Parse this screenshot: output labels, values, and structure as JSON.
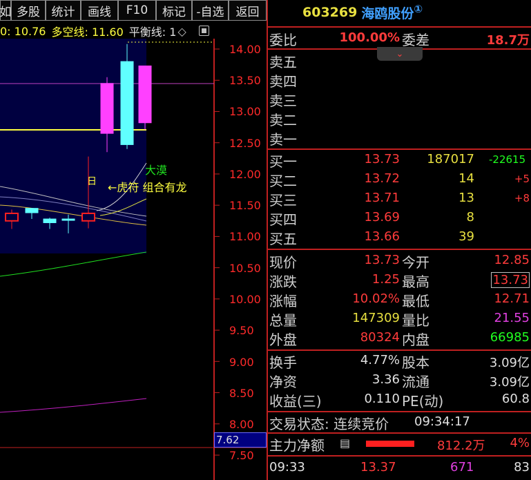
{
  "toolbar": {
    "buttons": [
      "如",
      "多股",
      "统计",
      "画线",
      "F10",
      "标记",
      "-自选",
      "返回"
    ]
  },
  "indicator_line": {
    "prefix": "0: 10.76",
    "dk_label": "多空线: 11.60",
    "ph_label": "平衡线: 1",
    "diamond": "◇"
  },
  "y_axis": {
    "labels": [
      "14.00",
      "13.50",
      "13.00",
      "12.50",
      "12.00",
      "11.50",
      "11.00",
      "10.50",
      "10.00",
      "9.50",
      "9.00",
      "8.50",
      "8.00",
      "7.50"
    ],
    "cursor_value": "7.62"
  },
  "annotations": {
    "da_mo": "大漠",
    "hu_fu": "←虎符 组合有龙",
    "ri": "日"
  },
  "stock": {
    "code": "603269",
    "name": "海鸥股份",
    "badge": "①"
  },
  "weibi": {
    "label": "委比",
    "value": "100.00%",
    "diff_label": "委差",
    "diff_value": "18.7万"
  },
  "expand_icon": "⌄",
  "sell": [
    {
      "label": "卖五"
    },
    {
      "label": "卖四"
    },
    {
      "label": "卖三"
    },
    {
      "label": "卖二"
    },
    {
      "label": "卖一"
    }
  ],
  "buy": [
    {
      "label": "买一",
      "price": "13.73",
      "vol": "187017",
      "chg": "-22615"
    },
    {
      "label": "买二",
      "price": "13.72",
      "vol": "14",
      "chg": "+5"
    },
    {
      "label": "买三",
      "price": "13.71",
      "vol": "13",
      "chg": "+8"
    },
    {
      "label": "买四",
      "price": "13.69",
      "vol": "8",
      "chg": ""
    },
    {
      "label": "买五",
      "price": "13.66",
      "vol": "39",
      "chg": ""
    }
  ],
  "stats1": [
    {
      "l1": "现价",
      "v1": "13.73",
      "l2": "今开",
      "v2": "12.85"
    },
    {
      "l1": "涨跌",
      "v1": "1.25",
      "l2": "最高",
      "v2": "13.73"
    },
    {
      "l1": "涨幅",
      "v1": "10.02%",
      "l2": "最低",
      "v2": "12.71"
    },
    {
      "l1": "总量",
      "v1": "147309",
      "l2": "量比",
      "v2": "21.55"
    },
    {
      "l1": "外盘",
      "v1": "80324",
      "l2": "内盘",
      "v2": "66985"
    }
  ],
  "stats2": [
    {
      "l1": "换手",
      "v1": "4.77%",
      "l2": "股本",
      "v2": "3.09亿"
    },
    {
      "l1": "净资",
      "v1": "3.36",
      "l2": "流通",
      "v2": "3.09亿"
    },
    {
      "l1": "收益(三)",
      "v1": "0.110",
      "l2": "PE(动)",
      "v2": "60.8"
    }
  ],
  "trade_status": {
    "label": "交易状态: 连续竞价",
    "time": "09:34:17"
  },
  "net_flow": {
    "label": "主力净额",
    "icon": "▤",
    "value": "812.2万",
    "pct": "4%"
  },
  "tick": {
    "time": "09:33",
    "price": "13.37",
    "vol": "671",
    "num": "83"
  },
  "colors": {
    "up": "#ff3b3b",
    "down": "#20ff20",
    "candle_up": "#ff40ff",
    "candle_cyan": "#60ffff",
    "panel_bg": "#000030",
    "border": "#c02020"
  },
  "chart_data": {
    "type": "candlestick",
    "ylim": [
      7.3,
      14.3
    ],
    "candles": [
      {
        "open": 11.25,
        "close": 11.37,
        "high": 11.43,
        "low": 11.12
      },
      {
        "open": 11.45,
        "close": 11.38,
        "high": 11.45,
        "low": 11.28
      },
      {
        "open": 11.28,
        "close": 11.22,
        "high": 11.3,
        "low": 11.12
      },
      {
        "open": 11.28,
        "close": 11.26,
        "high": 11.35,
        "low": 11.05
      },
      {
        "open": 11.25,
        "close": 11.37,
        "high": 12.28,
        "low": 11.13
      },
      {
        "open": 12.65,
        "close": 13.45,
        "high": 13.55,
        "low": 12.35
      },
      {
        "open": 12.47,
        "close": 13.8,
        "high": 14.08,
        "low": 12.4
      },
      {
        "open": 12.82,
        "close": 13.73,
        "high": 13.73,
        "low": 12.71
      }
    ]
  }
}
